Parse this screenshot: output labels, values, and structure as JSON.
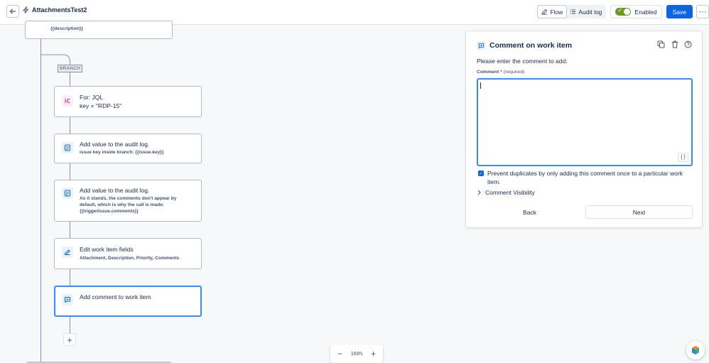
{
  "header": {
    "title": "AttachmentsTest2",
    "tabs": [
      {
        "label": "Flow",
        "icon": "pencil-icon",
        "active": true
      },
      {
        "label": "Audit log",
        "icon": "list-icon",
        "active": false
      }
    ],
    "enabled_label": "Enabled",
    "enabled": true,
    "save_label": "Save",
    "more_label": "⋯"
  },
  "canvas": {
    "top_node_text": "{{description}}",
    "branch_tag": "BRANCH",
    "nodes": [
      {
        "title": "For: JQL",
        "subtitle": "key = \"RDP-15\"",
        "icon": "branch-icon",
        "icon_color": "#ae4787"
      },
      {
        "title": "Add value to the audit log.",
        "subtitle": "issue key inside branch: {{issue.key}}",
        "icon": "log-icon",
        "icon_color": "#0c66e4"
      },
      {
        "title": "Add value to the audit log.",
        "subtitle_lines": [
          "As it stands, the comments don't appear by",
          "default, which is why the call is made:",
          "{{triggerIssue.comments}}"
        ],
        "icon": "log-icon",
        "icon_color": "#0c66e4"
      },
      {
        "title": "Edit work item fields",
        "subtitle": "Attachment, Description, Priority, Comments",
        "icon": "edit-icon",
        "icon_color": "#0c66e4"
      },
      {
        "title": "Add comment to work item",
        "icon": "comment-icon",
        "icon_color": "#0c66e4",
        "selected": true
      }
    ],
    "zoom_level": "100%",
    "zoom_out": "−",
    "zoom_in": "+",
    "add_label": "+"
  },
  "panel": {
    "title": "Comment on work item",
    "prompt": "Please enter the comment to add:",
    "field_label": "Comment",
    "required_mark": "*",
    "required_text": "(required)",
    "comment_value": "",
    "braces_label": "{ }",
    "checkbox_label": "Prevent duplicates by only adding this comment once to a particular work item.",
    "checkbox_checked": true,
    "visibility_label": "Comment Visibility",
    "back_label": "Back",
    "next_label": "Next"
  },
  "colors": {
    "accent": "#0c66e4",
    "selected_border": "#388bff",
    "toggle_on": "#6a9a23"
  }
}
